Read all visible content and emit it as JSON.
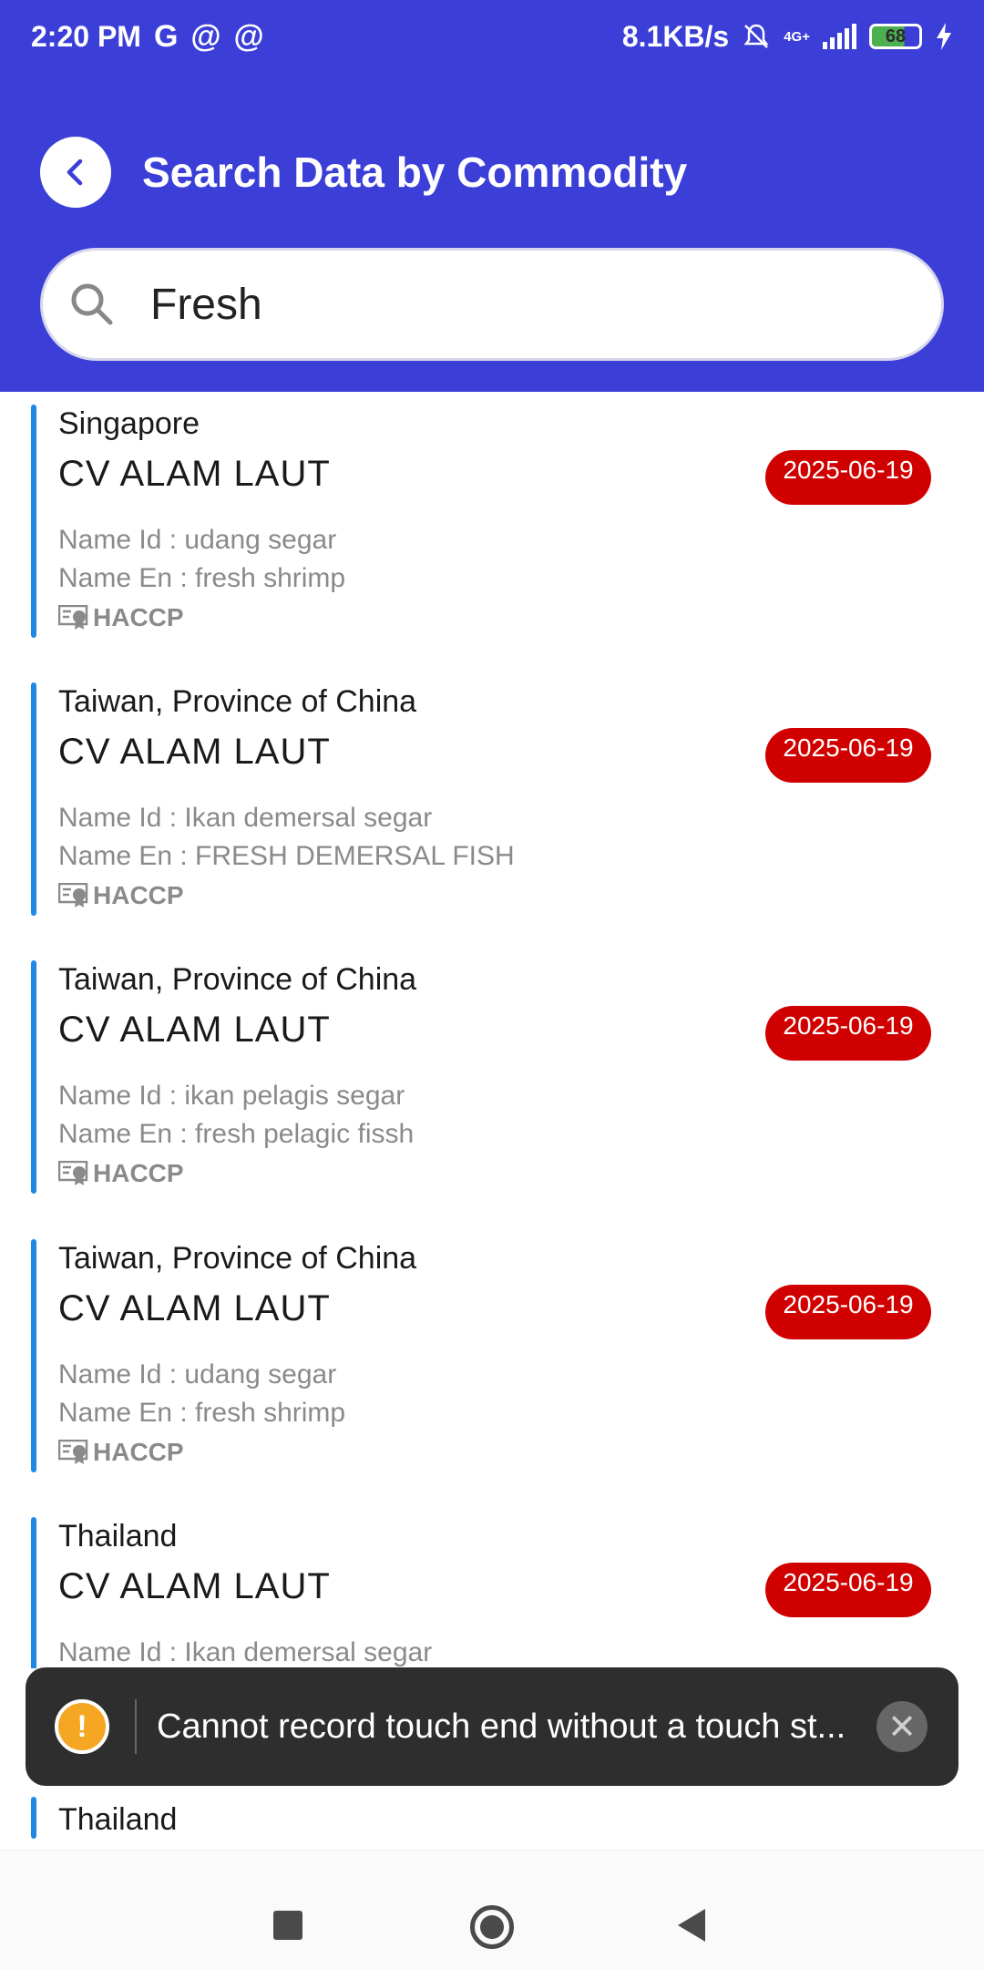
{
  "status_bar": {
    "time": "2:20 PM",
    "left_icons": [
      "G",
      "@",
      "@"
    ],
    "network_speed": "8.1KB/s",
    "network_type": "4G+",
    "battery_level": "68"
  },
  "header": {
    "title": "Search Data by Commodity",
    "background_color": "#3b3fd7"
  },
  "search": {
    "value": "Fresh",
    "placeholder": ""
  },
  "labels": {
    "name_id": "Name Id : ",
    "name_en": "Name En : "
  },
  "items": [
    {
      "country": "Singapore",
      "company": "CV ALAM LAUT",
      "date": "2025-06-19",
      "name_id": "Name Id :  udang segar",
      "name_en": "Name En :  fresh shrimp",
      "certification": "HACCP"
    },
    {
      "country": "Taiwan, Province of China",
      "company": "CV ALAM LAUT",
      "date": "2025-06-19",
      "name_id": "Name Id :  Ikan demersal segar",
      "name_en": "Name En :  FRESH DEMERSAL FISH",
      "certification": "HACCP"
    },
    {
      "country": "Taiwan, Province of China",
      "company": "CV ALAM LAUT",
      "date": "2025-06-19",
      "name_id": "Name Id :  ikan pelagis segar",
      "name_en": "Name En :  fresh pelagic fissh",
      "certification": "HACCP"
    },
    {
      "country": "Taiwan, Province of China",
      "company": "CV ALAM LAUT",
      "date": "2025-06-19",
      "name_id": "Name Id :  udang segar",
      "name_en": "Name En :  fresh shrimp",
      "certification": "HACCP"
    },
    {
      "country": "Thailand",
      "company": "CV ALAM LAUT",
      "date": "2025-06-19",
      "name_id": "Name Id :  Ikan demersal segar",
      "name_en": "",
      "certification": ""
    }
  ],
  "peek_item": {
    "country": "Thailand"
  },
  "toast": {
    "message": "Cannot record touch end without a touch st...",
    "icon": "warning-icon",
    "close_icon": "close-icon"
  },
  "nav_bar": {
    "icons": [
      "recents-icon",
      "home-icon",
      "back-icon"
    ]
  },
  "colors": {
    "accent": "#3b3fd7",
    "date_badge": "#d10000",
    "card_bar": "#1e88e5",
    "toast_bg": "#2e2e2e"
  }
}
